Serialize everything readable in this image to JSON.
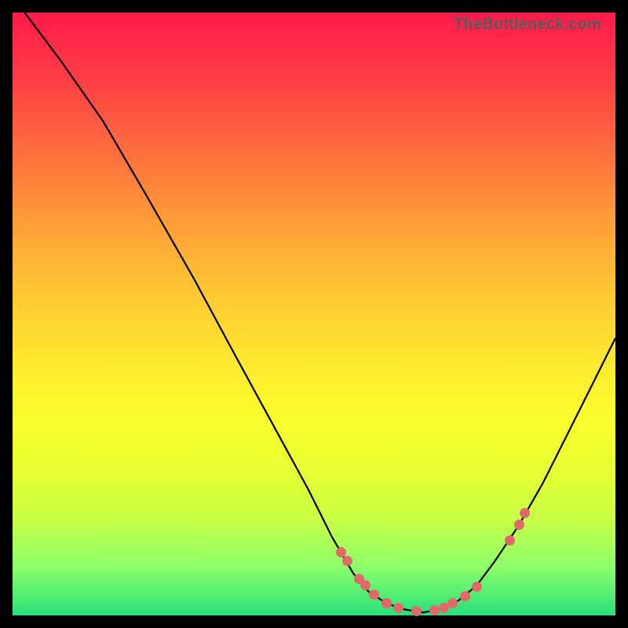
{
  "watermark": "TheBottleneck.com",
  "colors": {
    "curve": "#000000",
    "point": "#e06a6a"
  },
  "chart_data": {
    "type": "line",
    "title": "",
    "xlabel": "",
    "ylabel": "",
    "xlim": [
      0,
      100
    ],
    "ylim": [
      0,
      100
    ],
    "annotations": [],
    "series": [
      {
        "name": "bottleneck-curve",
        "x": [
          2,
          8,
          15,
          22,
          30,
          37,
          43,
          49,
          53,
          56.5,
          59,
          62,
          65,
          68,
          71,
          74,
          77,
          80,
          84,
          88,
          92,
          96,
          100
        ],
        "y": [
          100,
          92,
          82,
          70,
          56,
          43,
          32,
          21,
          13,
          7,
          4,
          2,
          1,
          0.5,
          1,
          2.5,
          5,
          9,
          15,
          22,
          30,
          38,
          46
        ]
      }
    ],
    "scatter_points": {
      "name": "highlight-points",
      "x": [
        54.5,
        55.5,
        57.5,
        58.5,
        60,
        62,
        64,
        67,
        70,
        71.5,
        73,
        75,
        77,
        82.5,
        84,
        85
      ],
      "y": [
        10.5,
        9,
        6,
        5,
        3.5,
        2,
        1.2,
        0.7,
        0.9,
        1.3,
        2,
        3.2,
        4.8,
        12.5,
        15,
        17
      ]
    }
  }
}
